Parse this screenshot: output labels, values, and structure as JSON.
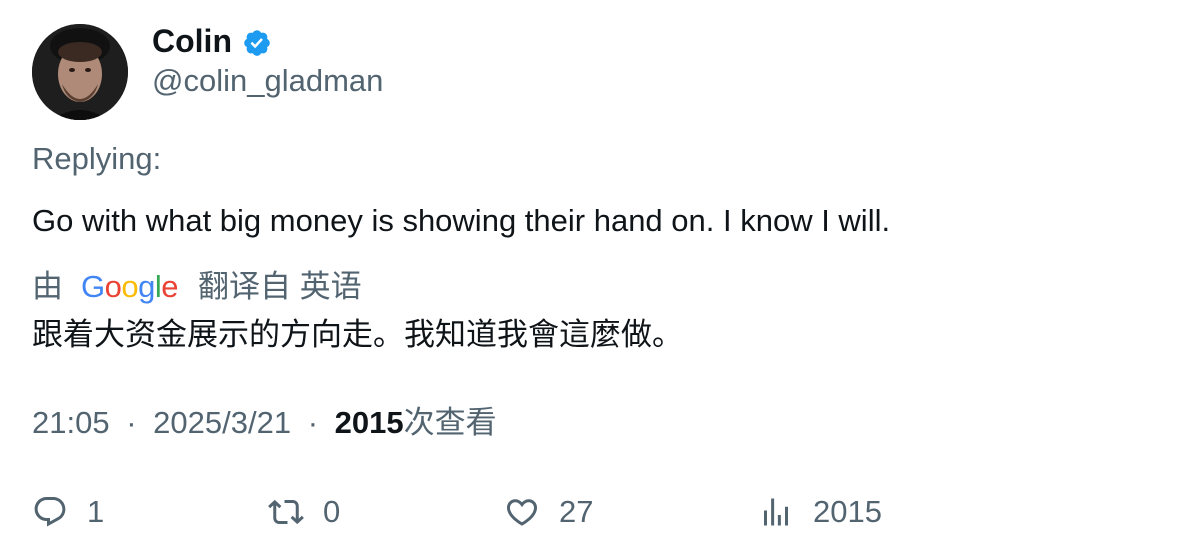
{
  "author": {
    "display_name": "Colin",
    "handle": "@colin_gladman",
    "verified": true
  },
  "replying_label": "Replying:",
  "tweet": {
    "text": "Go with what big money is showing their hand on. I know I will."
  },
  "translation": {
    "by_label": "由",
    "provider": "Google",
    "from_label": "翻译自 英语",
    "text": "跟着大资金展示的方向走。我知道我會這麼做。"
  },
  "meta": {
    "time": "21:05",
    "separator": "·",
    "date": "2025/3/21",
    "views_count": "2015",
    "views_label": "次查看"
  },
  "actions": {
    "reply": {
      "icon": "reply-icon",
      "count": "1"
    },
    "retweet": {
      "icon": "retweet-icon",
      "count": "0"
    },
    "like": {
      "icon": "heart-icon",
      "count": "27"
    },
    "views": {
      "icon": "views-icon",
      "count": "2015"
    }
  },
  "colors": {
    "text_primary": "#0f1419",
    "text_secondary": "#536471",
    "verified_blue": "#1d9bf0"
  }
}
